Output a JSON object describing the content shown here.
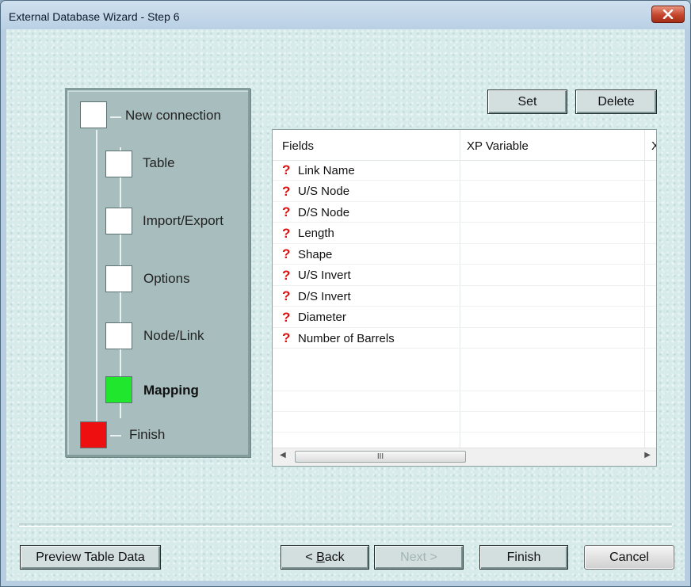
{
  "window": {
    "title": "External Database Wizard - Step 6"
  },
  "steps": [
    {
      "label": "New connection",
      "state": "done"
    },
    {
      "label": "Table",
      "state": "done"
    },
    {
      "label": "Import/Export",
      "state": "done"
    },
    {
      "label": "Options",
      "state": "done"
    },
    {
      "label": "Node/Link",
      "state": "done"
    },
    {
      "label": "Mapping",
      "state": "current"
    },
    {
      "label": "Finish",
      "state": "pending"
    }
  ],
  "grid": {
    "set_label": "Set",
    "delete_label": "Delete",
    "columns": [
      "Fields",
      "XP Variable",
      "X"
    ],
    "rows": [
      {
        "icon": "question-mark-icon",
        "field": "Link Name",
        "xp_variable": ""
      },
      {
        "icon": "question-mark-icon",
        "field": "U/S Node",
        "xp_variable": ""
      },
      {
        "icon": "question-mark-icon",
        "field": "D/S Node",
        "xp_variable": ""
      },
      {
        "icon": "question-mark-icon",
        "field": "Length",
        "xp_variable": ""
      },
      {
        "icon": "question-mark-icon",
        "field": "Shape",
        "xp_variable": ""
      },
      {
        "icon": "question-mark-icon",
        "field": "U/S Invert",
        "xp_variable": ""
      },
      {
        "icon": "question-mark-icon",
        "field": "D/S Invert",
        "xp_variable": ""
      },
      {
        "icon": "question-mark-icon",
        "field": "Diameter",
        "xp_variable": ""
      },
      {
        "icon": "question-mark-icon",
        "field": "Number of Barrels",
        "xp_variable": ""
      }
    ],
    "scrollbar_grip": "III"
  },
  "footer": {
    "preview_label": "Preview Table Data",
    "back_accel": "B",
    "back_rest": "ack",
    "back_prefix": "< ",
    "next_label": "Next >",
    "finish_label": "Finish",
    "cancel_label": "Cancel"
  },
  "colors": {
    "current_step": "#21e62e",
    "finish_step": "#ee1010",
    "required_icon": "#e01010",
    "close_button": "#c4452c"
  }
}
